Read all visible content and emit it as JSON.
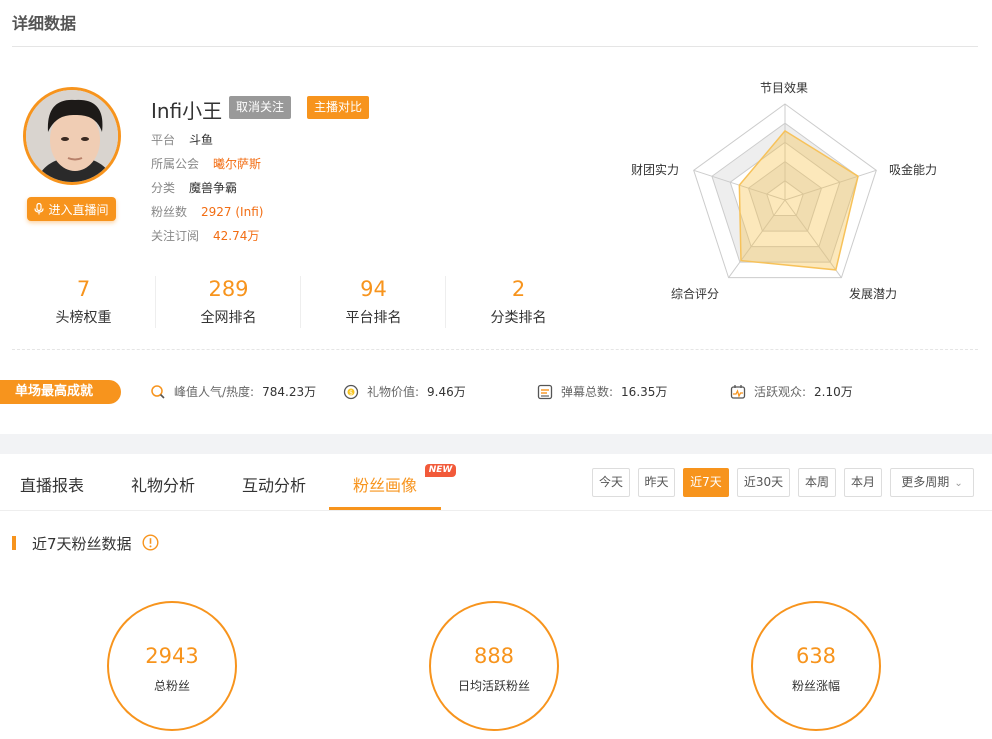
{
  "section": {
    "title": "详细数据"
  },
  "profile": {
    "name": "Infi小王",
    "unfollow_label": "取消关注",
    "compare_label": "主播对比",
    "live_room_label": "进入直播间",
    "info": [
      {
        "label": "平台",
        "value": "斗鱼",
        "accent": false
      },
      {
        "label": "所属公会",
        "value": "曦尔萨斯",
        "accent": true
      },
      {
        "label": "分类",
        "value": "魔兽争霸",
        "accent": false
      },
      {
        "label": "粉丝数",
        "value": "2927 (Infi)",
        "accent": true
      },
      {
        "label": "关注订阅",
        "value": "42.74万",
        "accent": true
      }
    ]
  },
  "ranks": [
    {
      "value": "7",
      "label": "头榜权重"
    },
    {
      "value": "289",
      "label": "全网排名"
    },
    {
      "value": "94",
      "label": "平台排名"
    },
    {
      "value": "2",
      "label": "分类排名"
    }
  ],
  "radar": {
    "labels": [
      "节目效果",
      "吸金能力",
      "发展潜力",
      "综合评分",
      "财团实力"
    ],
    "values": [
      0.72,
      0.8,
      0.9,
      0.78,
      0.5
    ]
  },
  "best": {
    "badge": "单场最高成就",
    "stats": [
      {
        "icon": "peak-popularity-icon",
        "label": "峰值人气/热度:",
        "value": "784.23万"
      },
      {
        "icon": "gift-value-icon",
        "label": "礼物价值:",
        "value": "9.46万"
      },
      {
        "icon": "danmaku-icon",
        "label": "弹幕总数:",
        "value": "16.35万"
      },
      {
        "icon": "active-viewers-icon",
        "label": "活跃观众:",
        "value": "2.10万"
      }
    ]
  },
  "tabs": [
    {
      "label": "直播报表",
      "active": false
    },
    {
      "label": "礼物分析",
      "active": false
    },
    {
      "label": "互动分析",
      "active": false
    },
    {
      "label": "粉丝画像",
      "active": true,
      "badge": "NEW"
    }
  ],
  "periods": [
    {
      "label": "今天",
      "active": false
    },
    {
      "label": "昨天",
      "active": false
    },
    {
      "label": "近7天",
      "active": true
    },
    {
      "label": "近30天",
      "active": false
    },
    {
      "label": "本周",
      "active": false
    },
    {
      "label": "本月",
      "active": false
    },
    {
      "label": "更多周期",
      "active": false,
      "dropdown": true
    }
  ],
  "fans": {
    "title": "近7天粉丝数据",
    "metrics": [
      {
        "value": "2943",
        "label": "总粉丝"
      },
      {
        "value": "888",
        "label": "日均活跃粉丝"
      },
      {
        "value": "638",
        "label": "粉丝涨幅"
      }
    ]
  },
  "colors": {
    "accent": "#f7941d",
    "accent_text": "#f26d13",
    "new_badge": "#f25a3a"
  }
}
